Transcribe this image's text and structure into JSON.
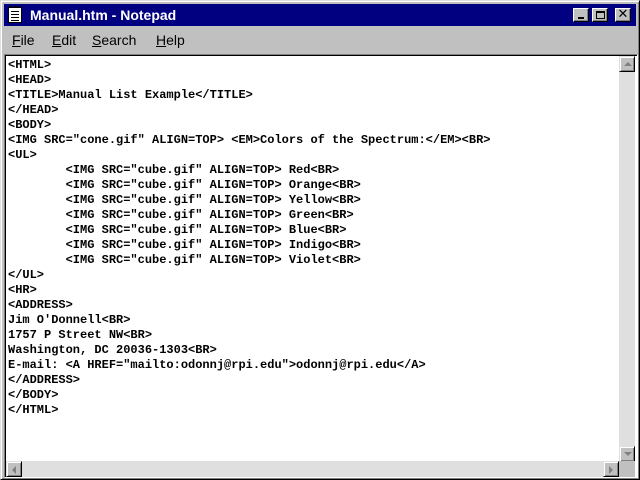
{
  "window": {
    "title": "Manual.htm - Notepad",
    "icon": "notepad-icon",
    "title_bar_color": "#000080",
    "controls": [
      "minimize-icon",
      "maximize-icon",
      "close-icon"
    ],
    "close_glyph": "✕"
  },
  "menu": {
    "items": [
      {
        "accel": "F",
        "rest": "ile"
      },
      {
        "accel": "E",
        "rest": "dit"
      },
      {
        "accel": "S",
        "rest": "earch"
      },
      {
        "accel": "H",
        "rest": "elp"
      }
    ]
  },
  "document": {
    "content": "<HTML>\n<HEAD>\n<TITLE>Manual List Example</TITLE>\n</HEAD>\n<BODY>\n<IMG SRC=\"cone.gif\" ALIGN=TOP> <EM>Colors of the Spectrum:</EM><BR>\n<UL>\n        <IMG SRC=\"cube.gif\" ALIGN=TOP> Red<BR>\n        <IMG SRC=\"cube.gif\" ALIGN=TOP> Orange<BR>\n        <IMG SRC=\"cube.gif\" ALIGN=TOP> Yellow<BR>\n        <IMG SRC=\"cube.gif\" ALIGN=TOP> Green<BR>\n        <IMG SRC=\"cube.gif\" ALIGN=TOP> Blue<BR>\n        <IMG SRC=\"cube.gif\" ALIGN=TOP> Indigo<BR>\n        <IMG SRC=\"cube.gif\" ALIGN=TOP> Violet<BR>\n</UL>\n<HR>\n<ADDRESS>\nJim O'Donnell<BR>\n1757 P Street NW<BR>\nWashington, DC 20036-1303<BR>\nE-mail: <A HREF=\"mailto:odonnj@rpi.edu\">odonnj@rpi.edu</A>\n</ADDRESS>\n</BODY>\n</HTML>"
  }
}
